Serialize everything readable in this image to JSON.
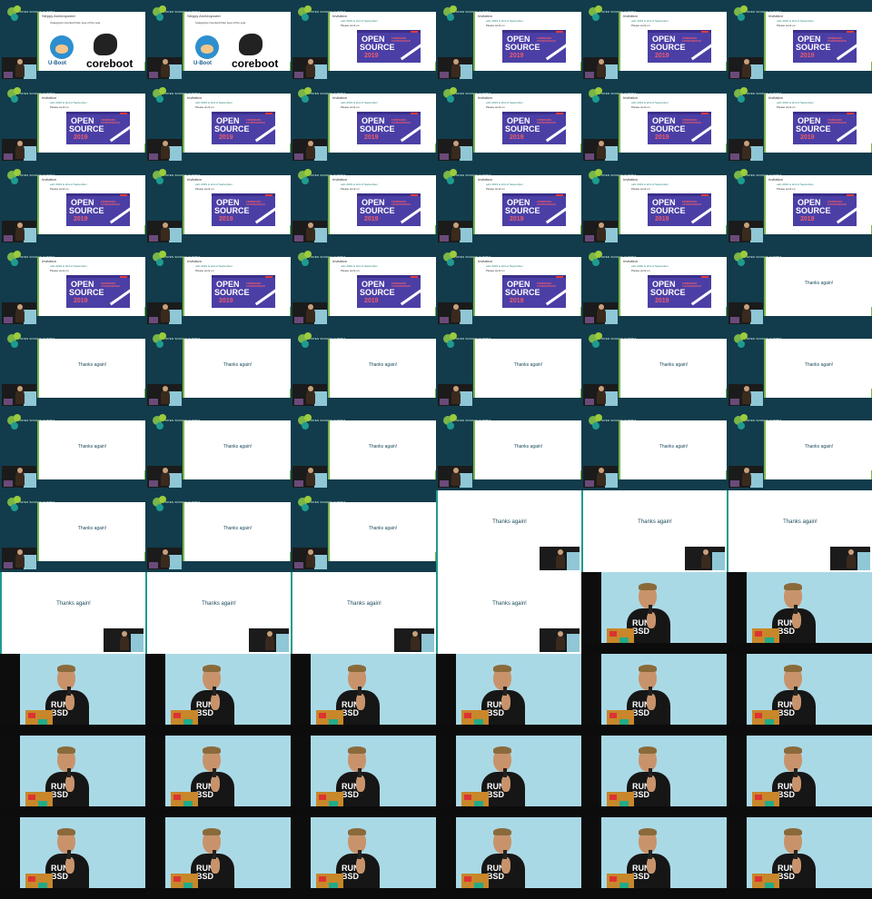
{
  "slides": {
    "sleepy_title": "Sleppy Archeoposter",
    "sleepy_bullet": "Categories invented finite type of the year",
    "uboot_label": "U-Boot",
    "coreboot_label": "coreboot",
    "invitation_title": "Invitation",
    "invitation_bullets": [
      "osfc 2019 is 2nd of September",
      "Please work on"
    ],
    "banner_open": "OPEN",
    "banner_source": "SOURCE",
    "banner_year": "2019",
    "banner_firmware": "FIRMWARE CONFERENCE",
    "thanks": "Thanks again!"
  },
  "speaker": {
    "shirt_line1": "RUN",
    "shirt_line2": "BSD"
  },
  "logo_text": "OPEN SOURCE SUMMIT",
  "layout": {
    "columns": 6,
    "rows": 11,
    "sequence": [
      "sleepy",
      "sleepy",
      "invitation",
      "invitation",
      "invitation",
      "invitation",
      "invitation",
      "invitation",
      "invitation",
      "invitation",
      "invitation",
      "invitation",
      "invitation",
      "invitation",
      "invitation",
      "invitation",
      "invitation",
      "invitation",
      "invitation",
      "invitation",
      "invitation",
      "invitation",
      "invitation",
      "thanks",
      "thanks",
      "thanks",
      "thanks",
      "thanks",
      "thanks",
      "thanks",
      "thanks",
      "thanks",
      "thanks",
      "thanks",
      "thanks",
      "thanks",
      "thanks",
      "thanks",
      "thanks",
      "thanks-full",
      "thanks-full",
      "thanks-full",
      "thanks-full",
      "thanks-full",
      "thanks-full",
      "thanks-full",
      "speaker",
      "speaker",
      "speaker",
      "speaker",
      "speaker",
      "speaker",
      "speaker",
      "speaker",
      "speaker",
      "speaker",
      "speaker",
      "speaker",
      "speaker",
      "speaker",
      "speaker",
      "speaker",
      "speaker",
      "speaker",
      "speaker",
      "speaker"
    ]
  }
}
